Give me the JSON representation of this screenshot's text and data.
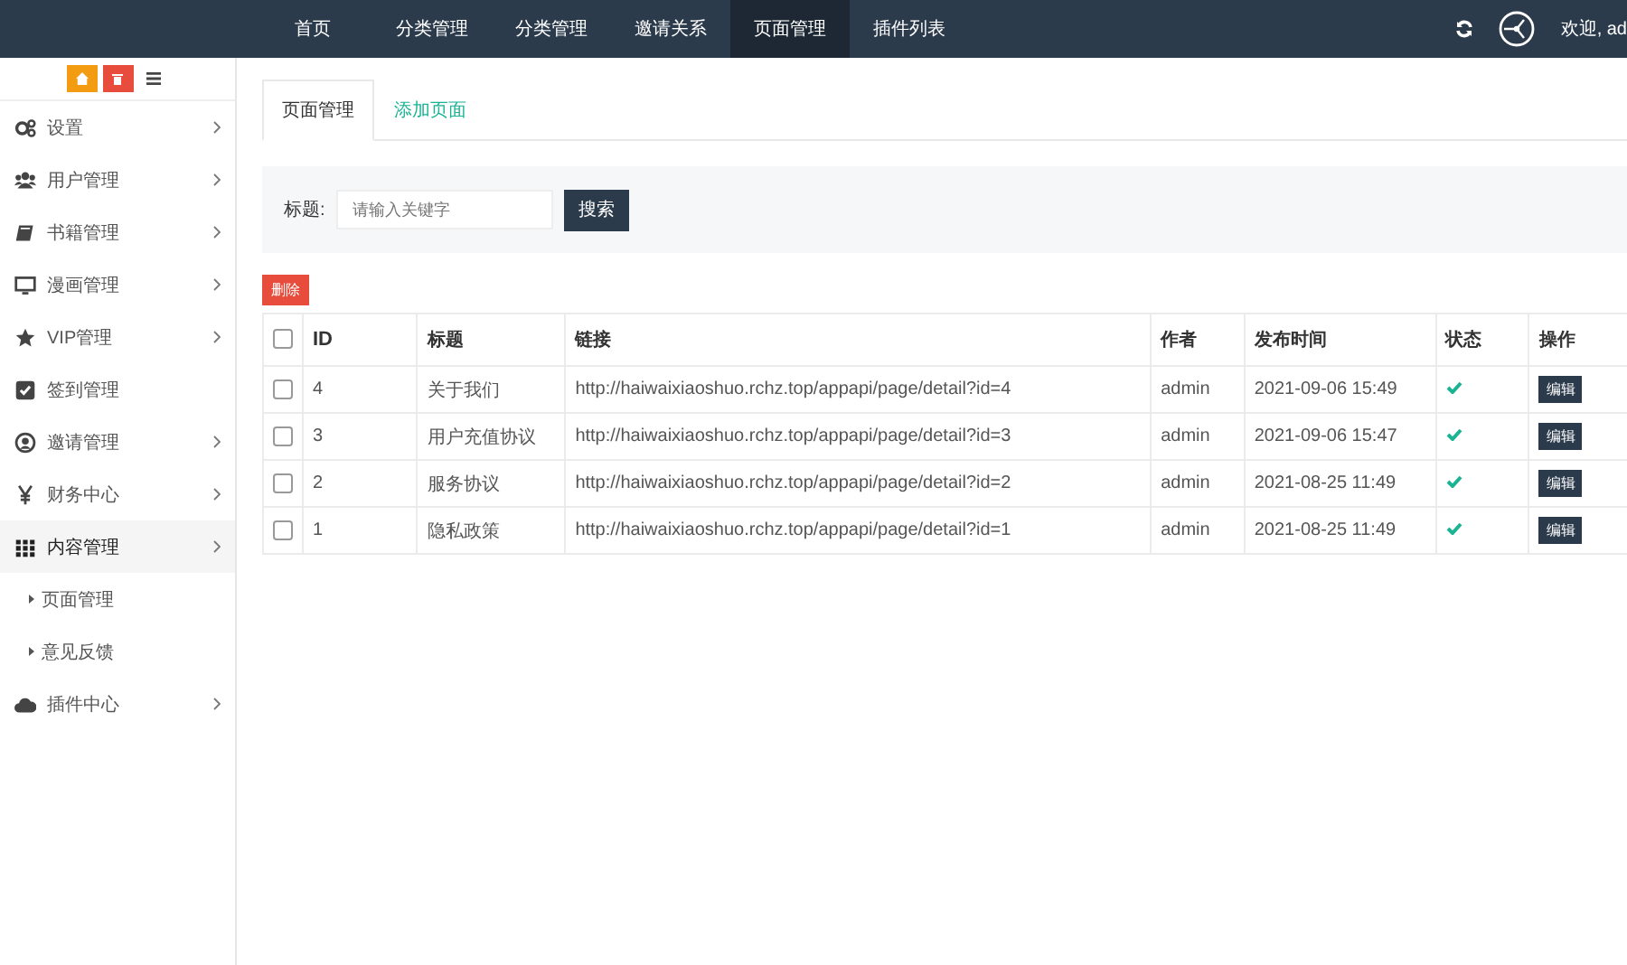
{
  "top_nav": {
    "items": [
      {
        "label": "首页",
        "selected": false
      },
      {
        "label": "分类管理",
        "selected": false
      },
      {
        "label": "分类管理",
        "selected": false
      },
      {
        "label": "邀请关系",
        "selected": false
      },
      {
        "label": "页面管理",
        "selected": true
      },
      {
        "label": "插件列表",
        "selected": false
      }
    ],
    "welcome": "欢迎, ad"
  },
  "sidebar": {
    "items": [
      {
        "kind": "gear",
        "label": "设置",
        "expandable": true,
        "expanded": false
      },
      {
        "kind": "users",
        "label": "用户管理",
        "expandable": true,
        "expanded": false
      },
      {
        "kind": "book",
        "label": "书籍管理",
        "expandable": true,
        "expanded": false
      },
      {
        "kind": "monitor",
        "label": "漫画管理",
        "expandable": true,
        "expanded": false
      },
      {
        "kind": "star",
        "label": "VIP管理",
        "expandable": true,
        "expanded": false
      },
      {
        "kind": "check",
        "label": "签到管理",
        "expandable": false,
        "expanded": false
      },
      {
        "kind": "user",
        "label": "邀请管理",
        "expandable": true,
        "expanded": false
      },
      {
        "kind": "yen",
        "label": "财务中心",
        "expandable": true,
        "expanded": false
      },
      {
        "kind": "grid",
        "label": "内容管理",
        "expandable": true,
        "expanded": true,
        "children": [
          {
            "label": "页面管理"
          },
          {
            "label": "意见反馈"
          }
        ]
      },
      {
        "kind": "cloud",
        "label": "插件中心",
        "expandable": true,
        "expanded": false
      }
    ]
  },
  "tabs": [
    {
      "label": "页面管理",
      "selected": true
    },
    {
      "label": "添加页面",
      "selected": false
    }
  ],
  "search": {
    "label": "标题:",
    "placeholder": "请输入关键字",
    "button": "搜索"
  },
  "delete_button": "删除",
  "table": {
    "header_checked": false,
    "columns": [
      "ID",
      "标题",
      "链接",
      "作者",
      "发布时间",
      "状态",
      "操作"
    ],
    "rows": [
      {
        "checked": false,
        "id": "4",
        "title": "关于我们",
        "link": "http://haiwaixiaoshuo.rchz.top/appapi/page/detail?id=4",
        "author": "admin",
        "time": "2021-09-06 15:49",
        "status": true,
        "action": "编辑"
      },
      {
        "checked": false,
        "id": "3",
        "title": "用户充值协议",
        "link": "http://haiwaixiaoshuo.rchz.top/appapi/page/detail?id=3",
        "author": "admin",
        "time": "2021-09-06 15:47",
        "status": true,
        "action": "编辑"
      },
      {
        "checked": false,
        "id": "2",
        "title": "服务协议",
        "link": "http://haiwaixiaoshuo.rchz.top/appapi/page/detail?id=2",
        "author": "admin",
        "time": "2021-08-25 11:49",
        "status": true,
        "action": "编辑"
      },
      {
        "checked": false,
        "id": "1",
        "title": "隐私政策",
        "link": "http://haiwaixiaoshuo.rchz.top/appapi/page/detail?id=1",
        "author": "admin",
        "time": "2021-08-25 11:49",
        "status": true,
        "action": "编辑"
      }
    ]
  }
}
